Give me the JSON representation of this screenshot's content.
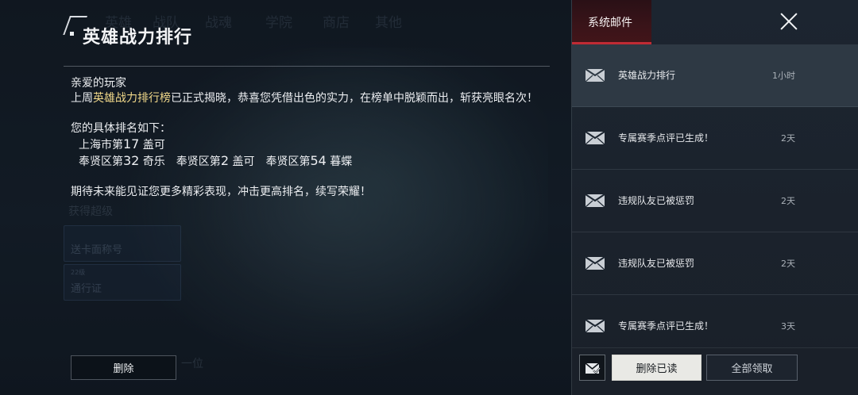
{
  "background": {
    "tabs": [
      "英雄",
      "战队",
      "战魂",
      "学院",
      "商店",
      "其他"
    ],
    "cards": [
      {
        "sub": "送卡面称号",
        "title": "送卡面称号"
      },
      {
        "sub": "22级",
        "title": "通行证"
      }
    ],
    "labels": [
      "获得超级",
      "一位"
    ]
  },
  "mail": {
    "title": "英雄战力排行",
    "greeting": "亲爱的玩家",
    "line1_prefix": "上周",
    "line1_highlight": "英雄战力排行榜",
    "line1_suffix": "已正式揭晓，恭喜您凭借出色的实力，在榜单中脱颖而出，斩获亮眼名次！",
    "ranking_intro": "您的具体排名如下：",
    "rank_row1_a": "上海市第",
    "rank_row1_num": "17",
    "rank_row1_b": " 盖可",
    "rank_row2_a": "奉贤区第",
    "rank_row2_num1": "32",
    "rank_row2_b": " 奇乐　奉贤区第",
    "rank_row2_num2": "2",
    "rank_row2_c": " 盖可　奉贤区第",
    "rank_row2_num3": "54",
    "rank_row2_d": " 暮蝶",
    "closing": "期待未来能见证您更多精彩表现，冲击更高排名，续写荣耀！",
    "delete_label": "删除"
  },
  "panel": {
    "tab_label": "系统邮件",
    "items": [
      {
        "title": "英雄战力排行",
        "time": "1小时",
        "selected": true
      },
      {
        "title": "专属赛季点评已生成！",
        "time": "2天"
      },
      {
        "title": "违规队友已被惩罚",
        "time": "2天"
      },
      {
        "title": "违规队友已被惩罚",
        "time": "2天"
      },
      {
        "title": "专属赛季点评已生成！",
        "time": "3天"
      }
    ],
    "delete_read_label": "删除已读",
    "claim_all_label": "全部领取"
  },
  "colors": {
    "highlight": "#f2d98a",
    "tab_accent": "#c12b34",
    "selected_row": "#2e3944"
  }
}
